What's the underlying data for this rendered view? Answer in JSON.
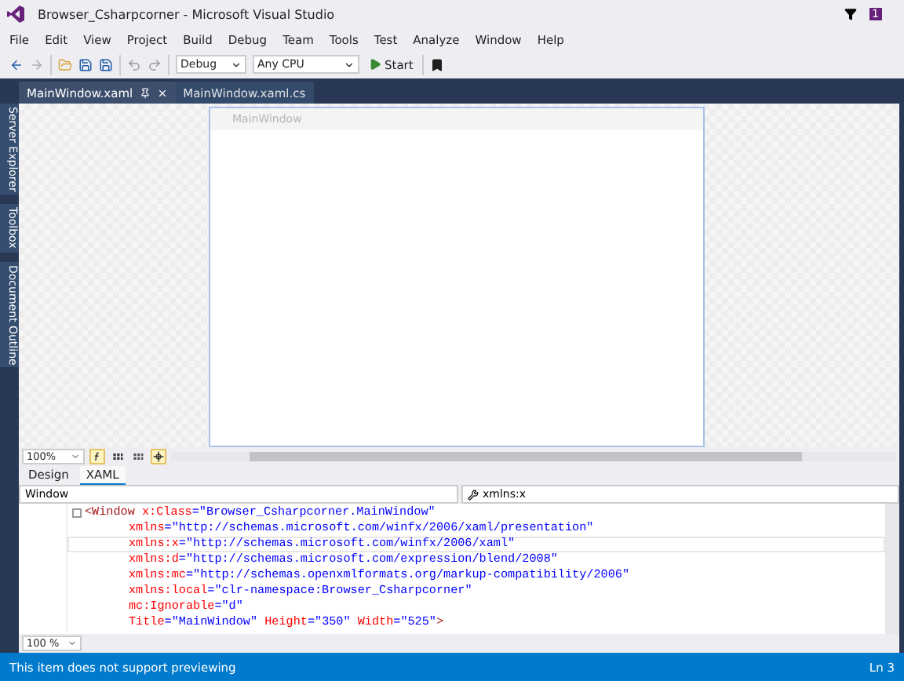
{
  "window": {
    "title": "Browser_Csharpcorner - Microsoft Visual Studio",
    "notification_count": "1"
  },
  "menu": [
    "File",
    "Edit",
    "View",
    "Project",
    "Build",
    "Debug",
    "Team",
    "Tools",
    "Test",
    "Analyze",
    "Window",
    "Help"
  ],
  "toolbar": {
    "configuration": "Debug",
    "platform": "Any CPU",
    "start": "Start"
  },
  "side_tabs": [
    "Server Explorer",
    "Toolbox",
    "Document Outline"
  ],
  "document_tabs": [
    {
      "label": "MainWindow.xaml",
      "selected": true
    },
    {
      "label": "MainWindow.xaml.cs",
      "selected": false
    }
  ],
  "designer": {
    "window_title": "MainWindow",
    "zoom": "100%"
  },
  "view_tabs": [
    {
      "label": "Design",
      "selected": false
    },
    {
      "label": "XAML",
      "selected": true
    }
  ],
  "navigation": {
    "element": "Window",
    "member": "xmlns:x"
  },
  "code_lines": [
    {
      "current": false,
      "fold": true,
      "segments": [
        {
          "kind": "tag",
          "text": "<Window"
        },
        {
          "kind": "attr",
          "text": " x:Class"
        },
        {
          "kind": "value",
          "text": "=\"Browser_Csharpcorner.MainWindow\""
        }
      ]
    },
    {
      "current": false,
      "fold": false,
      "segments": [
        {
          "kind": "attr",
          "text": "xmlns"
        },
        {
          "kind": "value",
          "text": "=\"http://schemas.microsoft.com/winfx/2006/xaml/presentation\""
        }
      ]
    },
    {
      "current": true,
      "fold": false,
      "segments": [
        {
          "kind": "attr",
          "text": "xmlns:x"
        },
        {
          "kind": "value",
          "text": "=\"http://schemas.microsoft.com/winfx/2006/xaml\""
        }
      ]
    },
    {
      "current": false,
      "fold": false,
      "segments": [
        {
          "kind": "attr",
          "text": "xmlns:d"
        },
        {
          "kind": "value",
          "text": "=\"http://schemas.microsoft.com/expression/blend/2008\""
        }
      ]
    },
    {
      "current": false,
      "fold": false,
      "segments": [
        {
          "kind": "attr",
          "text": "xmlns:mc"
        },
        {
          "kind": "value",
          "text": "=\"http://schemas.openxmlformats.org/markup-compatibility/2006\""
        }
      ]
    },
    {
      "current": false,
      "fold": false,
      "segments": [
        {
          "kind": "attr",
          "text": "xmlns:local"
        },
        {
          "kind": "value",
          "text": "=\"clr-namespace:Browser_Csharpcorner\""
        }
      ]
    },
    {
      "current": false,
      "fold": false,
      "segments": [
        {
          "kind": "attr",
          "text": "mc:Ignorable"
        },
        {
          "kind": "value",
          "text": "=\"d\""
        }
      ]
    },
    {
      "current": false,
      "fold": false,
      "segments": [
        {
          "kind": "attr",
          "text": "Title"
        },
        {
          "kind": "value",
          "text": "=\"MainWindow\""
        },
        {
          "kind": "attr",
          "text": " Height"
        },
        {
          "kind": "value",
          "text": "=\"350\""
        },
        {
          "kind": "attr",
          "text": " Width"
        },
        {
          "kind": "value",
          "text": "=\"525\""
        },
        {
          "kind": "tag",
          "text": ">"
        }
      ]
    }
  ],
  "code_zoom": "100 %",
  "status_bar": {
    "message": "This item does not support previewing",
    "position": "Ln 3"
  }
}
